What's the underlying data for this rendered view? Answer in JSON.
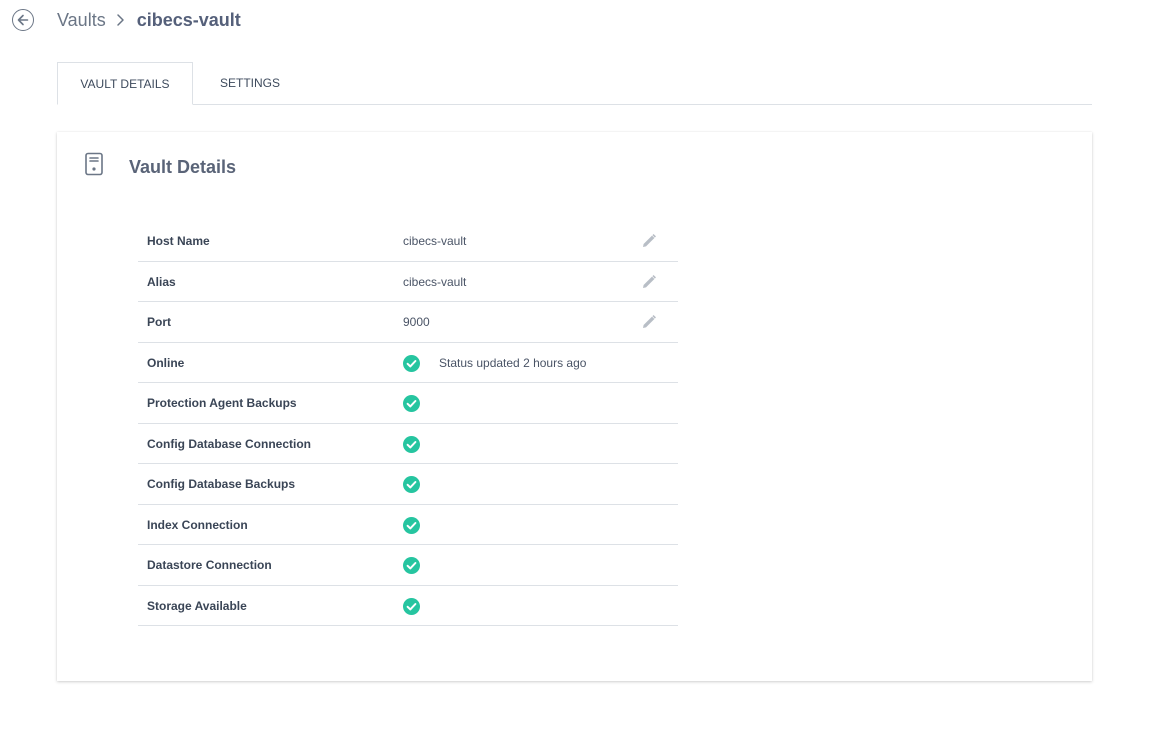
{
  "breadcrumb": {
    "root": "Vaults",
    "current": "cibecs-vault"
  },
  "tabs": [
    {
      "label": "VAULT DETAILS",
      "active": true
    },
    {
      "label": "SETTINGS",
      "active": false
    }
  ],
  "card": {
    "title": "Vault Details",
    "icon": "server-icon"
  },
  "details": {
    "host_name": {
      "label": "Host Name",
      "value": "cibecs-vault"
    },
    "alias": {
      "label": "Alias",
      "value": "cibecs-vault"
    },
    "port": {
      "label": "Port",
      "value": "9000"
    },
    "online": {
      "label": "Online",
      "status": "ok",
      "note": "Status updated 2 hours ago"
    },
    "protection_agent_backups": {
      "label": "Protection Agent Backups",
      "status": "ok"
    },
    "config_database_connection": {
      "label": "Config Database Connection",
      "status": "ok"
    },
    "config_database_backups": {
      "label": "Config Database Backups",
      "status": "ok"
    },
    "index_connection": {
      "label": "Index Connection",
      "status": "ok"
    },
    "datastore_connection": {
      "label": "Datastore Connection",
      "status": "ok"
    },
    "storage_available": {
      "label": "Storage Available",
      "status": "ok"
    }
  },
  "colors": {
    "ok": "#26c5a0",
    "muted_icon": "#b8bec6",
    "text": "#3d4a5c"
  }
}
